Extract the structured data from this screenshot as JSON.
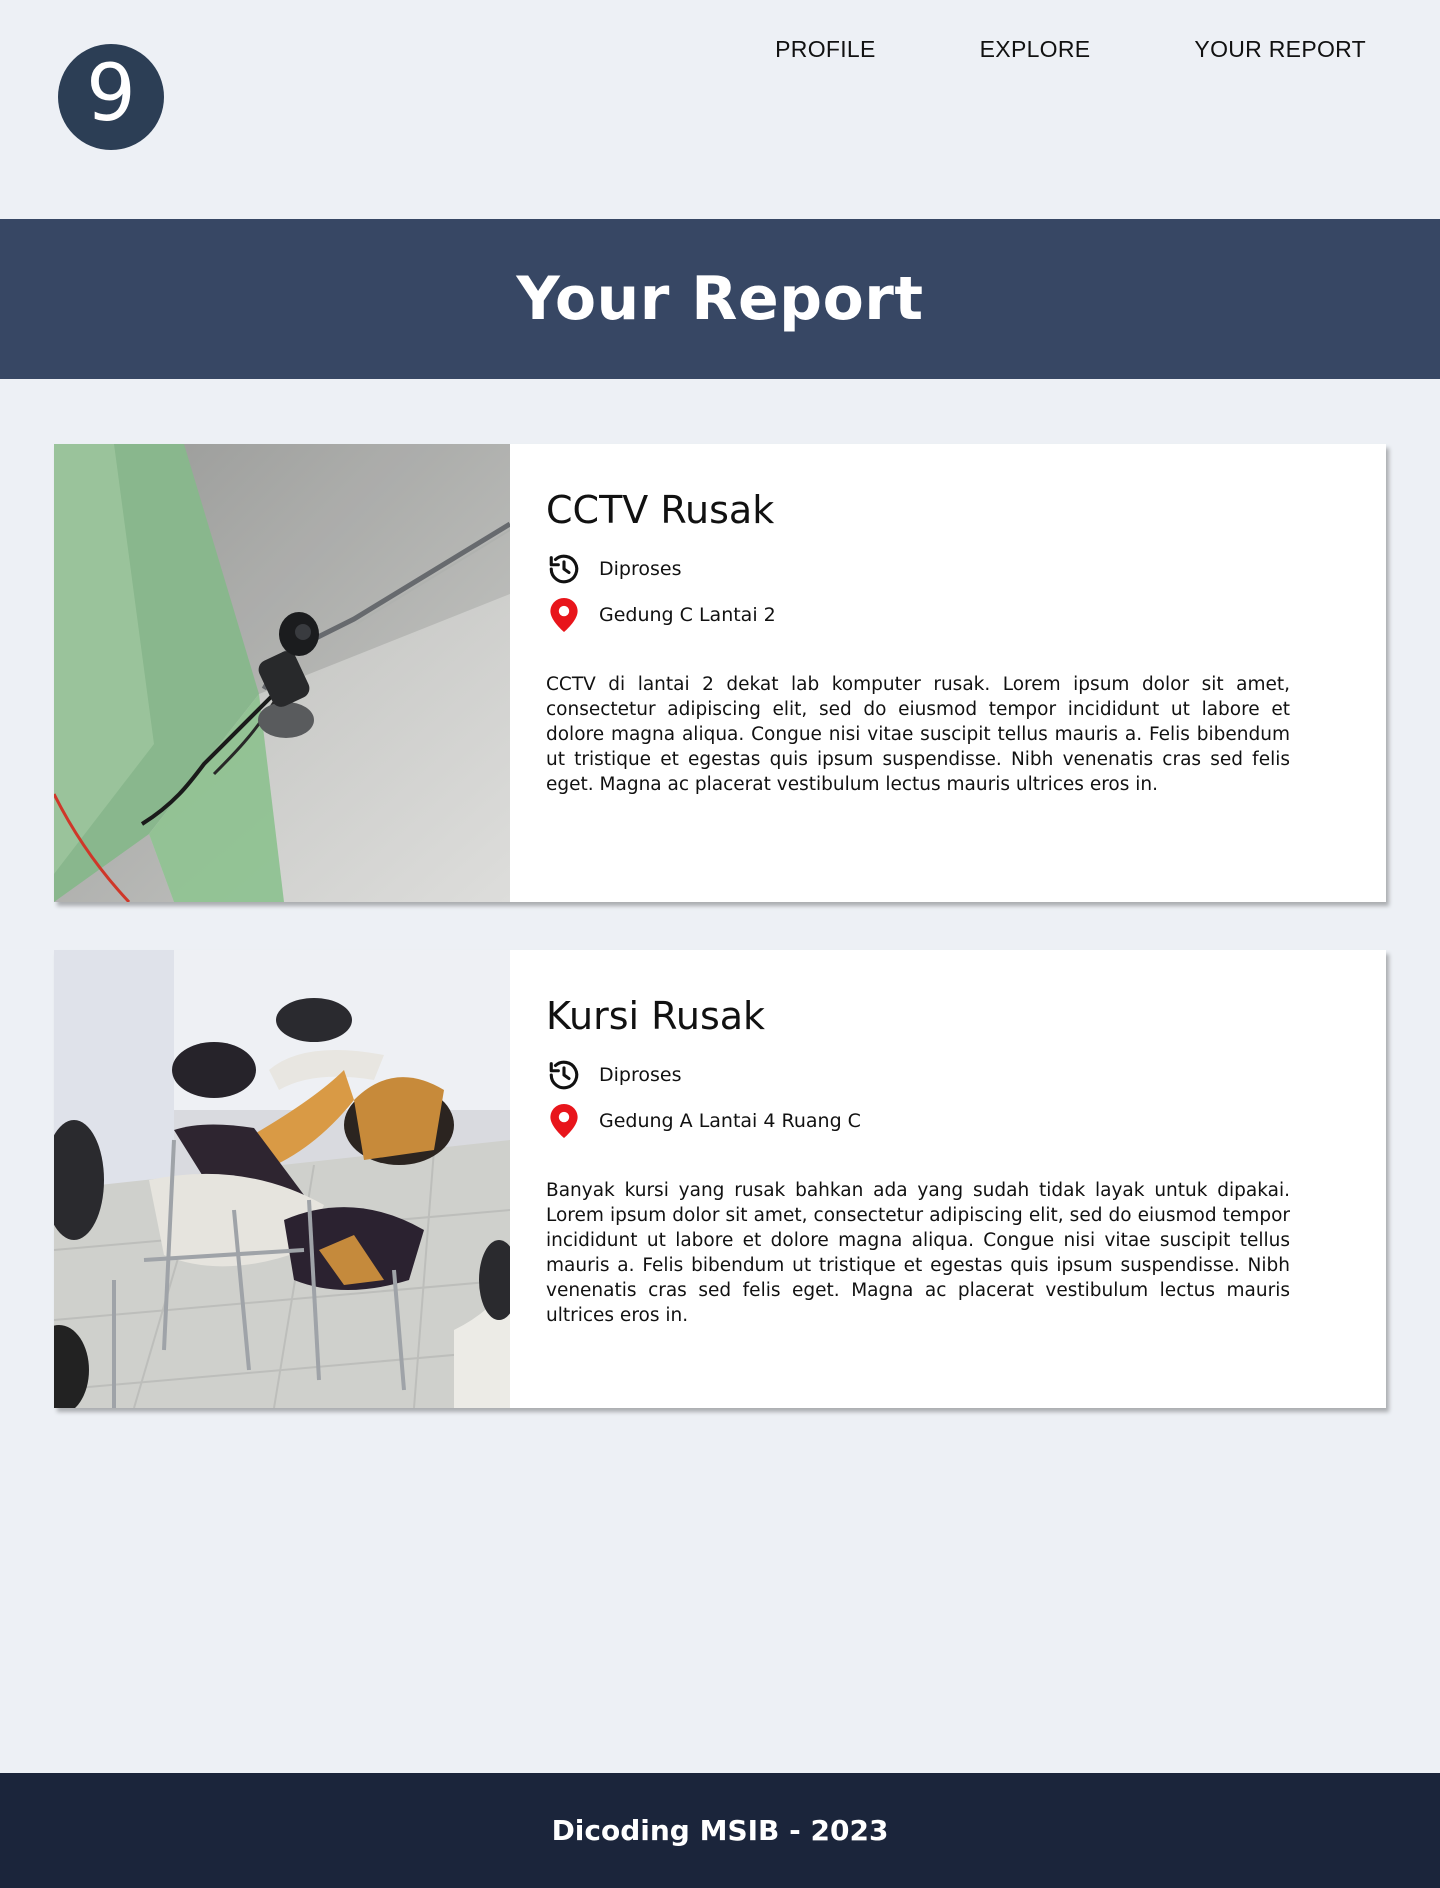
{
  "logo": {
    "glyph": "9"
  },
  "nav": {
    "items": [
      {
        "label": "PROFILE"
      },
      {
        "label": "EXPLORE"
      },
      {
        "label": "YOUR REPORT"
      }
    ]
  },
  "hero": {
    "title": "Your Report"
  },
  "reports": [
    {
      "title": "CCTV Rusak",
      "status": "Diproses",
      "location": "Gedung C Lantai 2",
      "description": "CCTV di lantai 2 dekat lab komputer rusak. Lorem ipsum dolor sit amet, consectetur adipiscing elit, sed do eiusmod tempor incididunt ut labore et dolore magna aliqua. Congue nisi vitae suscipit tellus mauris a. Felis bibendum ut tristique et egestas quis ipsum suspendisse. Nibh venenatis cras sed felis eget. Magna ac placerat vestibulum lectus mauris ultrices eros in."
    },
    {
      "title": "Kursi Rusak",
      "status": "Diproses",
      "location": "Gedung A Lantai 4 Ruang C",
      "description": "Banyak kursi yang rusak bahkan ada yang sudah tidak layak untuk dipakai. Lorem ipsum dolor sit amet, consectetur adipiscing elit, sed do eiusmod tempor incididunt ut labore et dolore magna aliqua. Congue nisi vitae suscipit tellus mauris a. Felis bibendum ut tristique et egestas quis ipsum suspendisse. Nibh venenatis cras sed felis eget. Magna ac placerat vestibulum lectus mauris ultrices eros in."
    }
  ],
  "footer": {
    "text": "Dicoding MSIB - 2023"
  },
  "colors": {
    "page_bg": "#edf0f5",
    "hero_bg": "#374764",
    "footer_bg": "#1b253b",
    "logo_bg": "#2c3e55",
    "location_pin": "#e8151b"
  },
  "icons": {
    "status": "history-icon",
    "location": "map-pin-icon"
  }
}
